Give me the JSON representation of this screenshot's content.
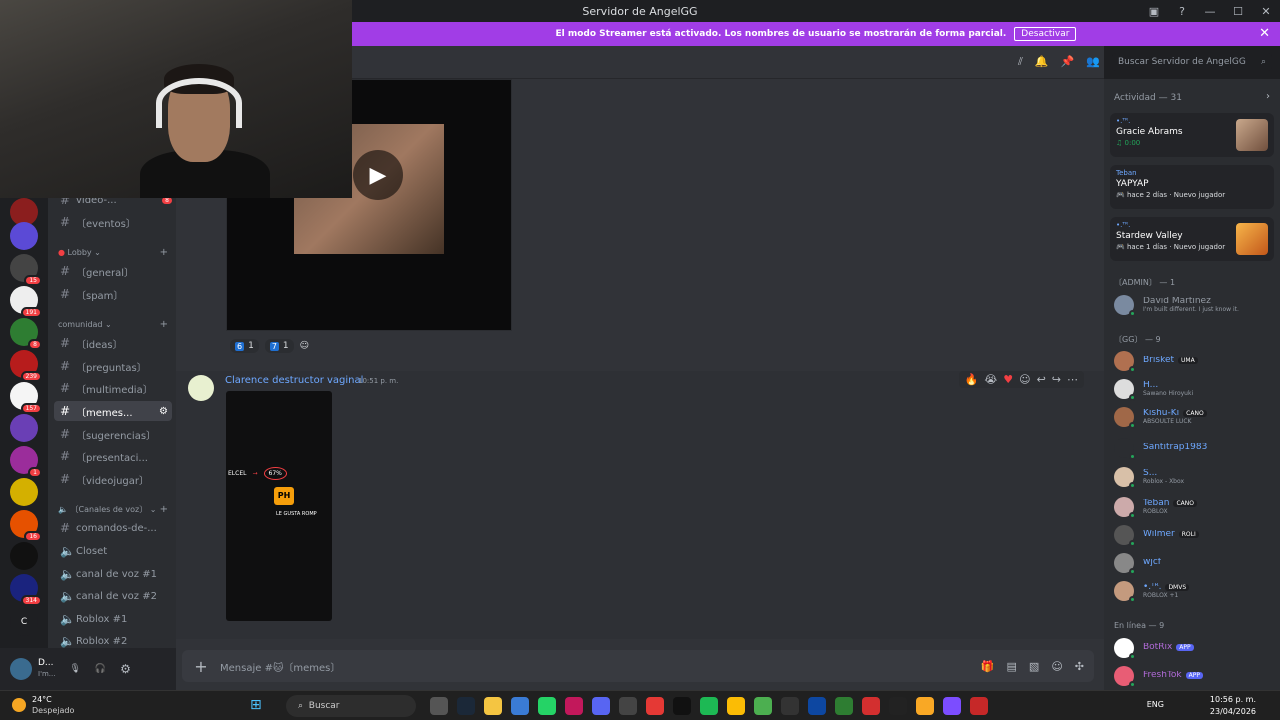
{
  "titlebar": {
    "title": "Servidor de AngelGG"
  },
  "streamer_banner": {
    "text": "El modo Streamer está activado. Los nombres de usuario se mostrarán de forma parcial.",
    "button": "Desactivar"
  },
  "search": {
    "placeholder": "Buscar Servidor de AngelGG"
  },
  "guild_badges": [
    "15",
    "191",
    "8",
    "239",
    "157",
    "1",
    "16",
    "314"
  ],
  "channels": {
    "top": [
      {
        "label": "video-...",
        "badge": "8"
      },
      {
        "label": "〔eventos〕"
      }
    ],
    "cat_lobby": "Lobby",
    "lobby": [
      {
        "label": "〔general〕"
      },
      {
        "label": "〔spam〕"
      }
    ],
    "cat_comunidad": "comunidad",
    "comunidad": [
      {
        "label": "〔ideas〕"
      },
      {
        "label": "〔preguntas〕"
      },
      {
        "label": "〔multimedia〕"
      },
      {
        "label": "〔memes...",
        "selected": true
      },
      {
        "label": "〔sugerencias〕"
      },
      {
        "label": "〔presentaci..."
      },
      {
        "label": "〔videojugar〕"
      }
    ],
    "cat_voz": "〔Canales de voz〕",
    "voz": [
      {
        "label": "comandos-de-..."
      },
      {
        "label": "Closet"
      },
      {
        "label": "canal de voz #1"
      },
      {
        "label": "canal de voz #2"
      },
      {
        "label": "Roblox #1"
      },
      {
        "label": "Roblox #2"
      }
    ]
  },
  "userbar": {
    "name": "D...",
    "status": "I'm..."
  },
  "messages": {
    "video_reactions": [
      {
        "emoji": "6",
        "count": "1"
      },
      {
        "emoji": "7",
        "count": "1"
      }
    ],
    "author": "Clarence destructor vaginal",
    "time": "10:51 p. m.",
    "screenshot": {
      "carrier": "ELCEL",
      "battery": "67%",
      "app": "PH",
      "caption": "LE GUSTA ROMP"
    }
  },
  "composer": {
    "placeholder": "Mensaje #🐱〔memes〕"
  },
  "members": {
    "activity_title": "Actividad — 31",
    "activities": [
      {
        "user": "•.ᵀᴿ.",
        "title": "Gracie Abrams",
        "detail": "0:00"
      },
      {
        "user": "Teban",
        "title": "YAPYAP",
        "detail": "hace 2 días",
        "extra": "Nuevo jugador"
      },
      {
        "user": "•.ᵀᴿ.",
        "title": "Stardew Valley",
        "detail": "hace 1 días",
        "extra": "Nuevo jugador"
      }
    ],
    "admin_title": "〔ADMIN〕 — 1",
    "admin": [
      {
        "name": "David Martinez",
        "sub": "I'm built different. I just know it."
      }
    ],
    "gg_title": "〔GG〕 — 9",
    "gg": [
      {
        "name": "Brisket",
        "tag": "UMA",
        "sub": ""
      },
      {
        "name": "H...",
        "tag": "",
        "sub": "Sawano Hiroyuki"
      },
      {
        "name": "Kishu-Ki",
        "tag": "CANO",
        "sub": "ABSOULTE LUCK"
      },
      {
        "name": "Santitrap1983",
        "tag": "",
        "sub": ""
      },
      {
        "name": "S...",
        "tag": "",
        "sub": "Roblox - Xbox"
      },
      {
        "name": "Teban",
        "tag": "CANO",
        "sub": "ROBLOX"
      },
      {
        "name": "Wilmer",
        "tag": "ROLI",
        "sub": ""
      },
      {
        "name": "wjcf",
        "tag": "",
        "sub": ""
      },
      {
        "name": "•.ᵀᴿ.",
        "tag": "DMVS",
        "sub": "ROBLOX +1"
      }
    ],
    "online_title": "En línea — 9",
    "online": [
      {
        "name": "BotRix",
        "tag": "APP"
      },
      {
        "name": "FreshTok",
        "tag": "APP"
      }
    ]
  },
  "taskbar": {
    "temp": "24°C",
    "weather": "Despejado",
    "search": "Buscar",
    "lang": "ENG",
    "time": "10:56 p. m.",
    "date": "23/04/2026"
  }
}
